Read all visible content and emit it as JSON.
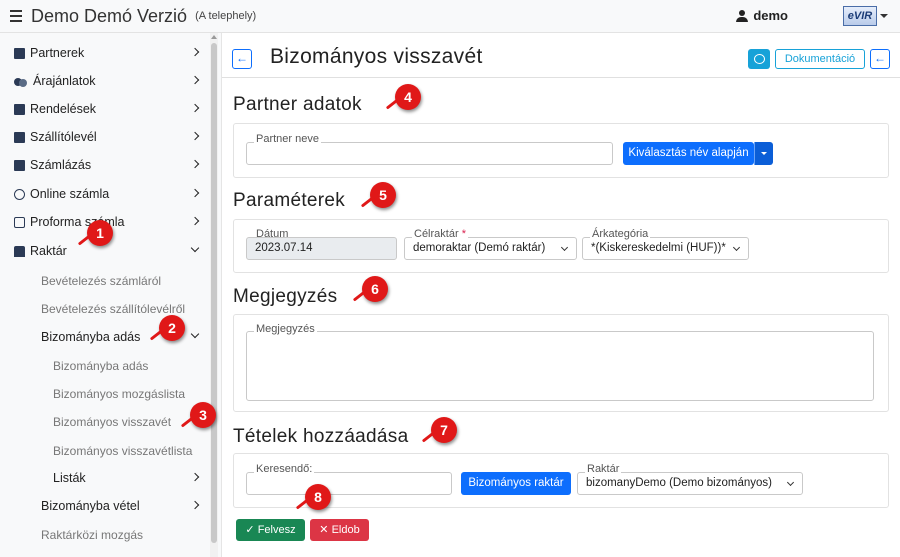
{
  "app": {
    "title": "Demo Demó Verzió",
    "subtitle": "(A telephely)",
    "user": "demo",
    "logo_text": "eVIR"
  },
  "sidebar": {
    "items": [
      {
        "label": "Partnerek",
        "icon": "address-card-icon"
      },
      {
        "label": "Árajánlatok",
        "icon": "people-icon"
      },
      {
        "label": "Rendelések",
        "icon": "document-icon"
      },
      {
        "label": "Szállítólevél",
        "icon": "clipboard-icon"
      },
      {
        "label": "Számlázás",
        "icon": "invoice-icon"
      },
      {
        "label": "Online számla",
        "icon": "globe-icon"
      },
      {
        "label": "Proforma számla",
        "icon": "proforma-icon"
      },
      {
        "label": "Raktár",
        "icon": "warehouse-icon"
      }
    ],
    "raktar_sub": [
      "Bevételezés számláról",
      "Bevételezés szállítólevélről"
    ],
    "bizomanyba_adas": "Bizományba adás",
    "bizomanyba_adas_sub": [
      "Bizományba adás",
      "Bizományos mozgáslista",
      "Bizományos visszavét",
      "Bizományos visszavétlista",
      "Listák"
    ],
    "after": [
      "Bizományba vétel",
      "Raktárközi mozgás"
    ]
  },
  "header": {
    "title": "Bizományos visszavét",
    "doc_label": "Dokumentáció"
  },
  "partner": {
    "title": "Partner adatok",
    "name_label": "Partner neve",
    "name_value": "",
    "select_btn": "Kiválasztás név alapján"
  },
  "params": {
    "title": "Paraméterek",
    "date_label": "Dátum",
    "date_value": "2023.07.14",
    "target_label": "Célraktár",
    "target_value": "demoraktar (Demó raktár)",
    "price_label": "Árkategória",
    "price_value": "*(Kiskereskedelmi (HUF))*"
  },
  "note": {
    "title": "Megjegyzés",
    "label": "Megjegyzés",
    "value": ""
  },
  "items": {
    "title": "Tételek hozzáadása",
    "search_label": "Keresendő:",
    "search_value": "",
    "stock_btn": "Bizományos raktár",
    "warehouse_label": "Raktár",
    "warehouse_value": "bizomanyDemo (Demo bizományos)"
  },
  "actions": {
    "save": "Felvesz",
    "discard": "Eldob"
  },
  "markers": [
    "1",
    "2",
    "3",
    "4",
    "5",
    "6",
    "7",
    "8"
  ],
  "colors": {
    "primary": "#0d6efd",
    "success": "#198754",
    "danger": "#dc3545",
    "info": "#17a2d8",
    "marker": "#e01818"
  }
}
